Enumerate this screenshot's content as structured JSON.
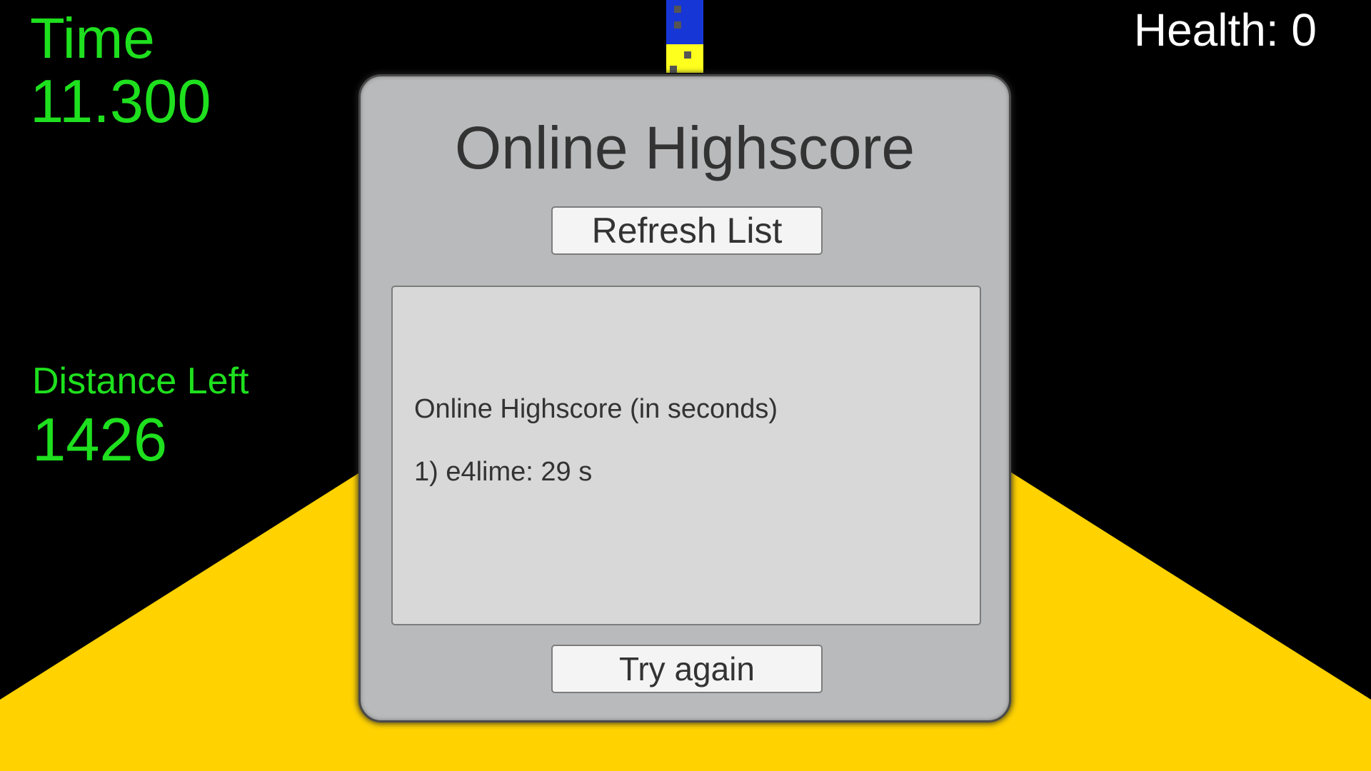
{
  "colors": {
    "background": "#000000",
    "track": "#ffd200",
    "hud_green": "#1ee01e",
    "hud_white": "#ffffff",
    "dialog_bg": "#b9babb",
    "panel_bg": "#d8d8d8",
    "button_bg": "#f4f4f4",
    "dialog_text": "#333333",
    "marker_blue": "#1636d6",
    "marker_yellow": "#ffff1e"
  },
  "hud": {
    "time_label": "Time",
    "time_value": "11.300",
    "distance_label": "Distance Left",
    "distance_value": "1426",
    "health": "Health: 0"
  },
  "dialog": {
    "title": "Online Highscore",
    "refresh_label": "Refresh List",
    "list_heading": "Online Highscore (in seconds)",
    "entries": [
      "1) e4lime: 29 s"
    ],
    "try_again_label": "Try again"
  }
}
